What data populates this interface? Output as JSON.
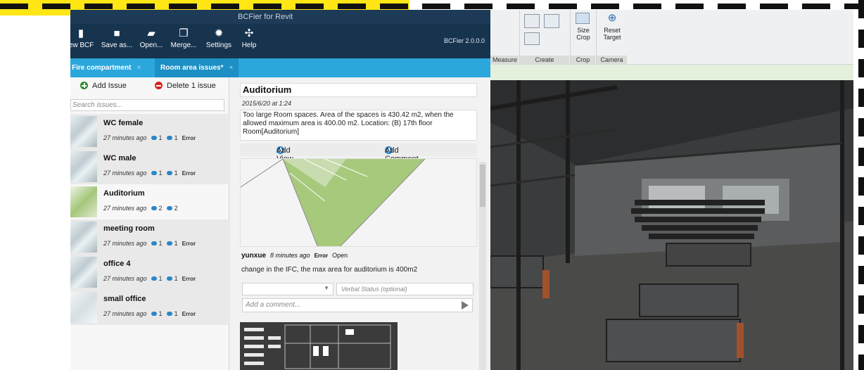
{
  "window": {
    "title": "BCFier for Revit",
    "version": "BCFier 2.0.0.0"
  },
  "toolbar": {
    "new_label": "New BCF",
    "save_as_label": "Save as...",
    "open_label": "Open...",
    "merge_label": "Merge...",
    "settings_label": "Settings",
    "help_label": "Help"
  },
  "tabs": [
    {
      "label": "Fire compartment",
      "close": "×"
    },
    {
      "label": "Room area issues*",
      "close": "×"
    }
  ],
  "issue_panel": {
    "add_issue": "Add Issue",
    "delete_issue": "Delete 1 issue",
    "search_placeholder": "Search issues...",
    "issues": [
      {
        "title": "WC female",
        "time": "27 minutes ago",
        "views": "1",
        "comments": "1",
        "status": "Error"
      },
      {
        "title": "WC male",
        "time": "27 minutes ago",
        "views": "1",
        "comments": "1",
        "status": "Error"
      },
      {
        "title": "Auditorium",
        "time": "27 minutes ago",
        "views": "2",
        "comments": "2",
        "status": ""
      },
      {
        "title": "meeting room",
        "time": "27 minutes ago",
        "views": "1",
        "comments": "1",
        "status": "Error"
      },
      {
        "title": "office 4",
        "time": "27 minutes ago",
        "views": "1",
        "comments": "1",
        "status": "Error"
      },
      {
        "title": "small office",
        "time": "27 minutes ago",
        "views": "1",
        "comments": "1",
        "status": "Error"
      }
    ]
  },
  "detail": {
    "title": "Auditorium",
    "date": "2015/6/20 at 1:24",
    "description": "Too large Room spaces. Area of the spaces is 430.42 m2, when the allowed maximum area is 400.00 m2. Location: (B) 17th floor Room[Auditorium]",
    "add_view": "Add View",
    "add_comment": "Add Comment",
    "comment": {
      "author": "yunxue",
      "time": "8 minutes ago",
      "status": "Error",
      "verbal": "Open",
      "text": "change in the IFC, the max area for auditorium is 400m2"
    },
    "verbal_status_placeholder": "Verbal Status (optional)",
    "add_comment_placeholder": "Add a comment..."
  },
  "ribbon": {
    "measure_label": "Measure",
    "create_label": "Create",
    "crop_label": "Crop",
    "camera_label": "Camera",
    "size_crop_label": "Size Crop",
    "reset_target_label": "Reset Target"
  },
  "colors": {
    "toolbar": "#17344f",
    "tabs": "#2ca7dc",
    "accent_highlight": "#ffe614"
  }
}
